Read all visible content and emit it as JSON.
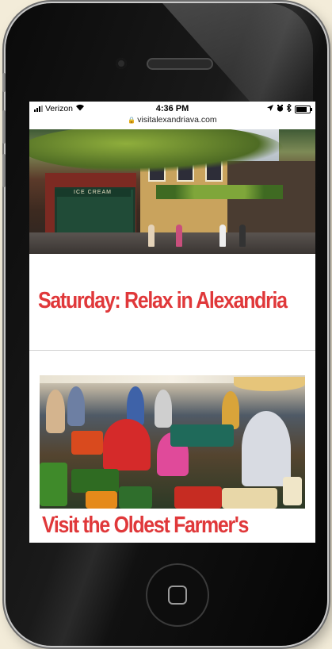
{
  "status_bar": {
    "carrier": "Verizon",
    "time": "4:36 PM",
    "wifi_icon": "wifi-icon",
    "location_icon": "location-arrow-icon",
    "alarm_icon": "alarm-icon",
    "bluetooth_icon": "bluetooth-icon",
    "battery_icon": "battery-icon"
  },
  "address_bar": {
    "url": "visitalexandriava.com",
    "lock_icon": "lock-icon"
  },
  "hero": {
    "shop_sign": "ICE CREAM"
  },
  "article": {
    "heading": "Saturday: Relax in Alexandria",
    "section_heading": "Visit the Oldest Farmer's"
  },
  "colors": {
    "heading": "#e0383a",
    "phone_body": "#0a0a0a",
    "background": "#f3ecd9"
  }
}
